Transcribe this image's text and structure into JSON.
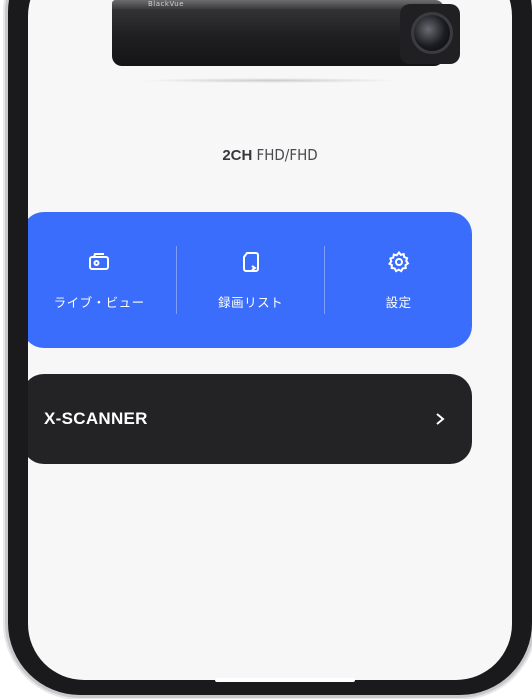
{
  "device_image": {
    "brand_mark": "BlackVue"
  },
  "model": {
    "channel": "2CH",
    "resolution": "FHD/FHD"
  },
  "actions": [
    {
      "label": "ライブ・ビュー",
      "icon": "camera-icon"
    },
    {
      "label": "録画リスト",
      "icon": "file-list-icon"
    },
    {
      "label": "設定",
      "icon": "gear-icon"
    }
  ],
  "scanner": {
    "label": "X-SCANNER",
    "icon": "chevron-right-icon"
  },
  "colors": {
    "accent_blue": "#3a6dfb",
    "dark_panel": "#232326",
    "screen_bg": "#f7f7f8"
  }
}
